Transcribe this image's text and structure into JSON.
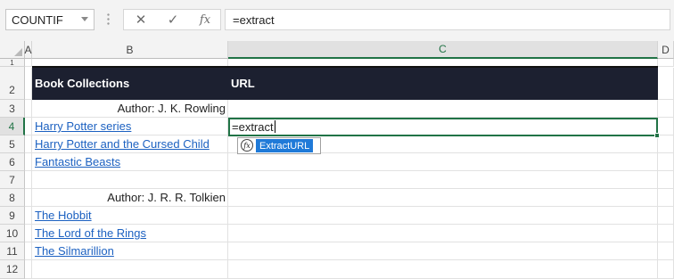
{
  "formula_bar": {
    "name_box": "COUNTIF",
    "cancel_icon": "✕",
    "enter_icon": "✓",
    "fx_label": "fx",
    "formula_text": "=extract"
  },
  "columns": [
    "A",
    "B",
    "C",
    "D"
  ],
  "rows": [
    "1",
    "2",
    "3",
    "4",
    "5",
    "6",
    "7",
    "8",
    "9",
    "10",
    "11",
    "12"
  ],
  "table": {
    "header_b": "Book Collections",
    "header_c": "URL",
    "author_1": "Author: J. K. Rowling",
    "author_2": "Author: J. R. R. Tolkien",
    "books": [
      "Harry Potter series ",
      "Harry Potter and the Cursed Child",
      "Fantastic Beasts",
      "The Hobbit ",
      "The Lord of the Rings ",
      "The Silmarillion"
    ]
  },
  "active_cell": {
    "text": "=extract"
  },
  "autocomplete": {
    "icon_label": "fx",
    "item": "ExtractURL"
  }
}
